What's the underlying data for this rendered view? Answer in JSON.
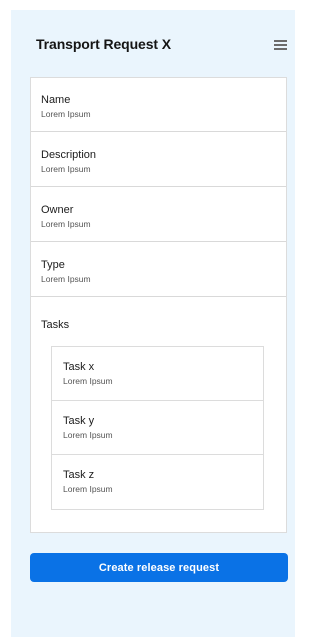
{
  "header": {
    "title": "Transport Request X",
    "menu_icon": "hamburger-menu-icon"
  },
  "fields": [
    {
      "label": "Name",
      "value": "Lorem Ipsum"
    },
    {
      "label": "Description",
      "value": "Lorem Ipsum"
    },
    {
      "label": "Owner",
      "value": "Lorem Ipsum"
    },
    {
      "label": "Type",
      "value": "Lorem Ipsum"
    }
  ],
  "tasks": {
    "label": "Tasks",
    "items": [
      {
        "label": "Task x",
        "value": "Lorem Ipsum"
      },
      {
        "label": "Task y",
        "value": "Lorem Ipsum"
      },
      {
        "label": "Task z",
        "value": "Lorem Ipsum"
      }
    ]
  },
  "actions": {
    "primary_label": "Create release request"
  },
  "colors": {
    "background": "#eaf5fd",
    "primary": "#0a72e6"
  }
}
